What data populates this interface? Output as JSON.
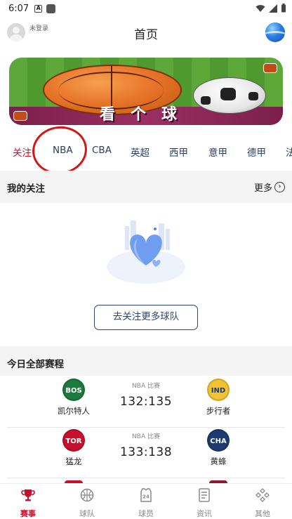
{
  "status_bar": {
    "time": "6:07",
    "icon_a": "A"
  },
  "header": {
    "login_text": "未登录",
    "title": "首页"
  },
  "banner": {
    "text": "看个球"
  },
  "tabs": [
    "关注",
    "NBA",
    "CBA",
    "英超",
    "西甲",
    "意甲",
    "德甲",
    "法"
  ],
  "active_tab": "关注",
  "my_follow": {
    "title": "我的关注",
    "more": "更多",
    "follow_button": "去关注更多球队"
  },
  "schedule": {
    "title": "今日全部赛程",
    "matches": [
      {
        "home_abbr": "BOS",
        "home_name": "凯尔特人",
        "home_color": "#1b7a3e",
        "league": "NBA 比赛",
        "score": "132:135",
        "away_abbr": "IND",
        "away_name": "步行者",
        "away_color": "#f2c230"
      },
      {
        "home_abbr": "TOR",
        "home_name": "猛龙",
        "home_color": "#c8102e",
        "league": "NBA 比赛",
        "score": "133:138",
        "away_abbr": "CHA",
        "away_name": "黄蜂",
        "away_color": "#1d3b73"
      }
    ]
  },
  "bottom_nav": [
    {
      "label": "赛事",
      "icon": "trophy-icon",
      "active": true
    },
    {
      "label": "球队",
      "icon": "basketball-icon",
      "active": false
    },
    {
      "label": "球员",
      "icon": "jersey-24-icon",
      "active": false,
      "icon_text": "24"
    },
    {
      "label": "资讯",
      "icon": "news-icon",
      "active": false
    },
    {
      "label": "其他",
      "icon": "grid-diamond-icon",
      "active": false
    }
  ]
}
